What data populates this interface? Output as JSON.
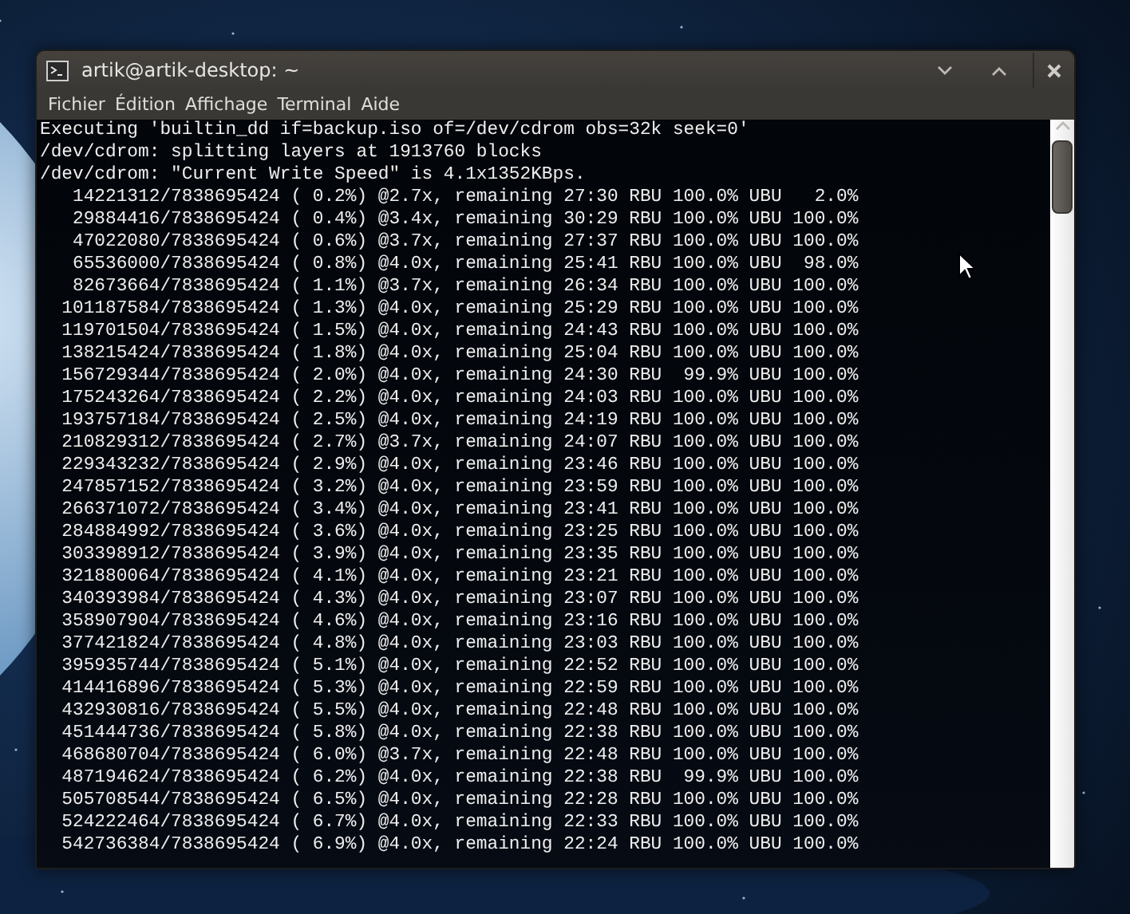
{
  "window": {
    "title": "artik@artik-desktop: ~"
  },
  "menu": [
    {
      "label": "Fichier"
    },
    {
      "label": "Édition"
    },
    {
      "label": "Affichage"
    },
    {
      "label": "Terminal"
    },
    {
      "label": "Aide"
    }
  ],
  "terminal": {
    "lines": [
      "Executing 'builtin_dd if=backup.iso of=/dev/cdrom obs=32k seek=0'",
      "/dev/cdrom: splitting layers at 1913760 blocks",
      "/dev/cdrom: \"Current Write Speed\" is 4.1x1352KBps.",
      "   14221312/7838695424 ( 0.2%) @2.7x, remaining 27:30 RBU 100.0% UBU   2.0%",
      "   29884416/7838695424 ( 0.4%) @3.4x, remaining 30:29 RBU 100.0% UBU 100.0%",
      "   47022080/7838695424 ( 0.6%) @3.7x, remaining 27:37 RBU 100.0% UBU 100.0%",
      "   65536000/7838695424 ( 0.8%) @4.0x, remaining 25:41 RBU 100.0% UBU  98.0%",
      "   82673664/7838695424 ( 1.1%) @3.7x, remaining 26:34 RBU 100.0% UBU 100.0%",
      "  101187584/7838695424 ( 1.3%) @4.0x, remaining 25:29 RBU 100.0% UBU 100.0%",
      "  119701504/7838695424 ( 1.5%) @4.0x, remaining 24:43 RBU 100.0% UBU 100.0%",
      "  138215424/7838695424 ( 1.8%) @4.0x, remaining 25:04 RBU 100.0% UBU 100.0%",
      "  156729344/7838695424 ( 2.0%) @4.0x, remaining 24:30 RBU  99.9% UBU 100.0%",
      "  175243264/7838695424 ( 2.2%) @4.0x, remaining 24:03 RBU 100.0% UBU 100.0%",
      "  193757184/7838695424 ( 2.5%) @4.0x, remaining 24:19 RBU 100.0% UBU 100.0%",
      "  210829312/7838695424 ( 2.7%) @3.7x, remaining 24:07 RBU 100.0% UBU 100.0%",
      "  229343232/7838695424 ( 2.9%) @4.0x, remaining 23:46 RBU 100.0% UBU 100.0%",
      "  247857152/7838695424 ( 3.2%) @4.0x, remaining 23:59 RBU 100.0% UBU 100.0%",
      "  266371072/7838695424 ( 3.4%) @4.0x, remaining 23:41 RBU 100.0% UBU 100.0%",
      "  284884992/7838695424 ( 3.6%) @4.0x, remaining 23:25 RBU 100.0% UBU 100.0%",
      "  303398912/7838695424 ( 3.9%) @4.0x, remaining 23:35 RBU 100.0% UBU 100.0%",
      "  321880064/7838695424 ( 4.1%) @4.0x, remaining 23:21 RBU 100.0% UBU 100.0%",
      "  340393984/7838695424 ( 4.3%) @4.0x, remaining 23:07 RBU 100.0% UBU 100.0%",
      "  358907904/7838695424 ( 4.6%) @4.0x, remaining 23:16 RBU 100.0% UBU 100.0%",
      "  377421824/7838695424 ( 4.8%) @4.0x, remaining 23:03 RBU 100.0% UBU 100.0%",
      "  395935744/7838695424 ( 5.1%) @4.0x, remaining 22:52 RBU 100.0% UBU 100.0%",
      "  414416896/7838695424 ( 5.3%) @4.0x, remaining 22:59 RBU 100.0% UBU 100.0%",
      "  432930816/7838695424 ( 5.5%) @4.0x, remaining 22:48 RBU 100.0% UBU 100.0%",
      "  451444736/7838695424 ( 5.8%) @4.0x, remaining 22:38 RBU 100.0% UBU 100.0%",
      "  468680704/7838695424 ( 6.0%) @3.7x, remaining 22:48 RBU 100.0% UBU 100.0%",
      "  487194624/7838695424 ( 6.2%) @4.0x, remaining 22:38 RBU  99.9% UBU 100.0%",
      "  505708544/7838695424 ( 6.5%) @4.0x, remaining 22:28 RBU 100.0% UBU 100.0%",
      "  524222464/7838695424 ( 6.7%) @4.0x, remaining 22:33 RBU 100.0% UBU 100.0%",
      "  542736384/7838695424 ( 6.9%) @4.0x, remaining 22:24 RBU 100.0% UBU 100.0%"
    ]
  }
}
